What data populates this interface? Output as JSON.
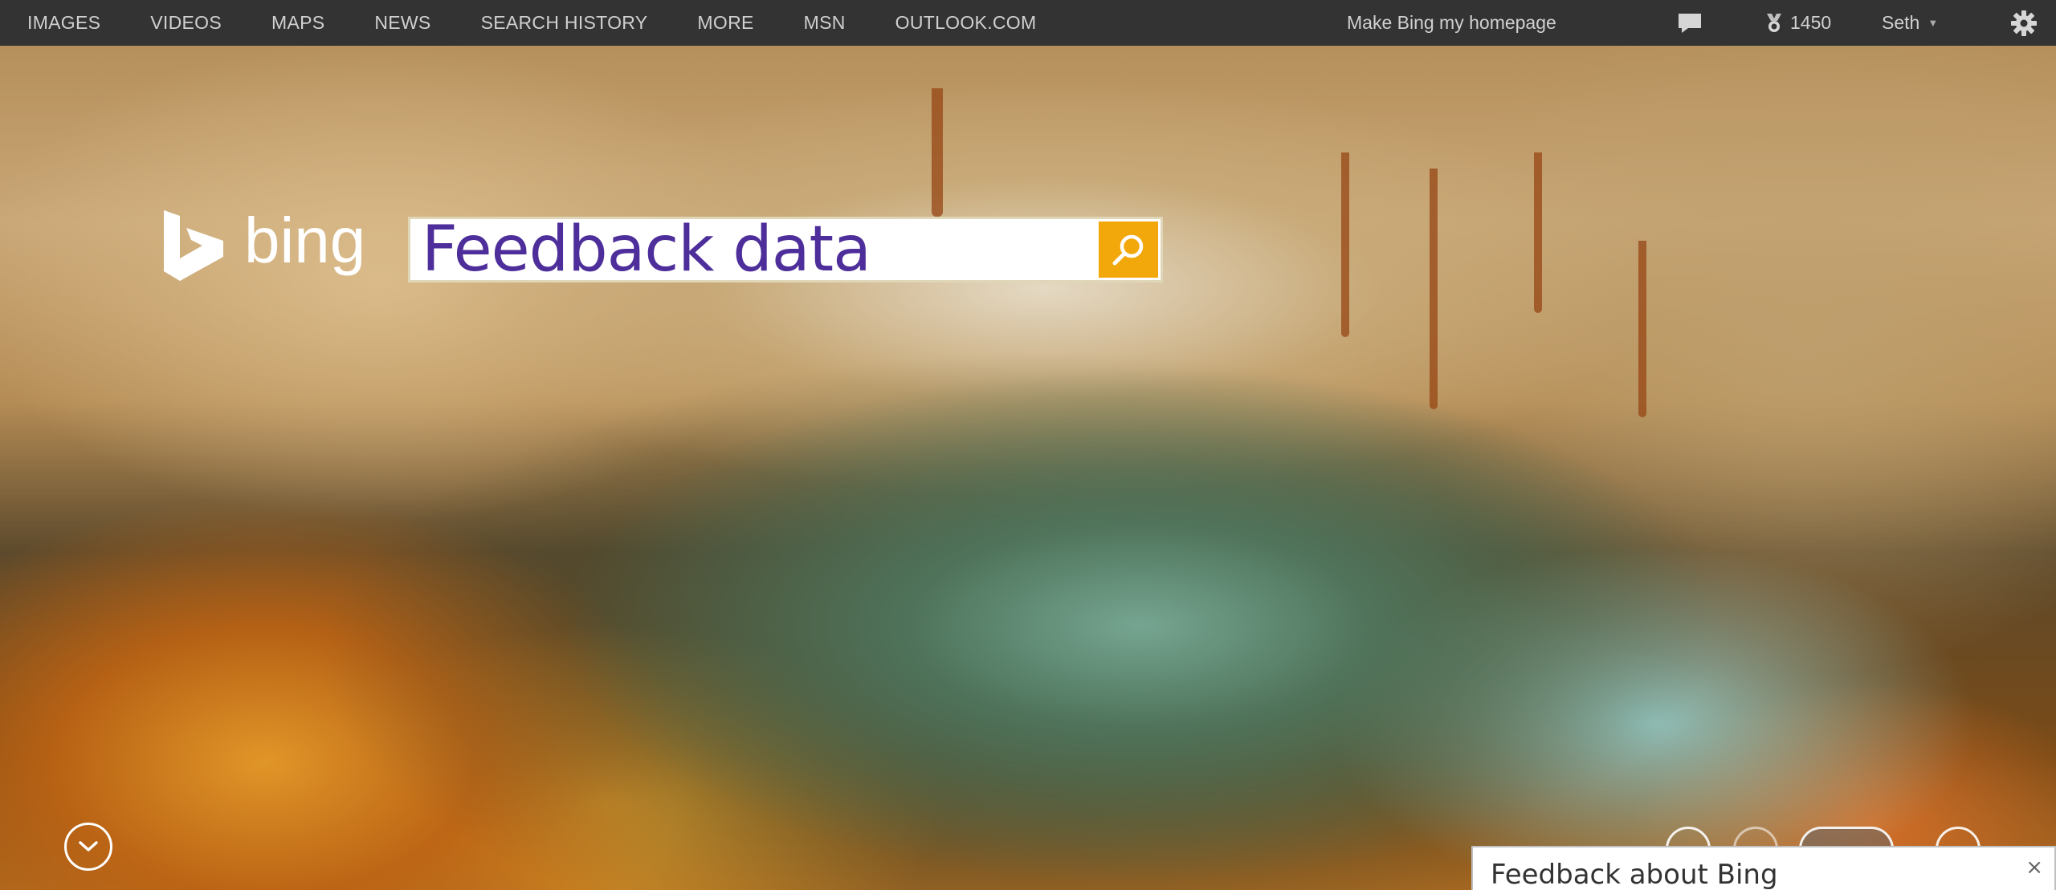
{
  "nav": {
    "items": [
      "IMAGES",
      "VIDEOS",
      "MAPS",
      "NEWS",
      "SEARCH HISTORY",
      "MORE",
      "MSN",
      "OUTLOOK.COM"
    ]
  },
  "header_right": {
    "homepage_link": "Make Bing my homepage",
    "feedback_icon": "speech-bubble-icon",
    "rewards_points": "1450",
    "rewards_icon": "medal-icon",
    "user_name": "Seth",
    "user_caret_icon": "caret-down-icon",
    "settings_icon": "gear-icon"
  },
  "logo": {
    "wordmark": "bing",
    "icon": "bing-b-icon"
  },
  "search": {
    "value": "Feedback data",
    "button_icon": "magnifier-icon"
  },
  "controls": {
    "scroll_down_icon": "chevron-down-icon"
  },
  "feedback_panel": {
    "title": "Feedback about Bing",
    "close_glyph": "×"
  },
  "colors": {
    "topbar_bg": "#333333",
    "search_text": "#4d2e9a",
    "search_button": "#f2a70a"
  }
}
